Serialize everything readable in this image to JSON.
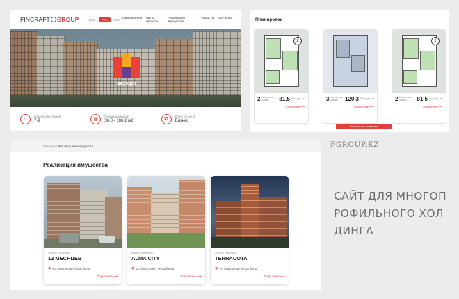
{
  "landing": {
    "logo_left": "FINCRAFT",
    "logo_right": "GROUP",
    "langs": [
      {
        "label": "QAZ",
        "active": false
      },
      {
        "label": "РУС",
        "active": true
      },
      {
        "label": "ENG",
        "active": false
      }
    ],
    "menu": [
      "Направления",
      "Мы о проекте",
      "Реализация имущества",
      "Новости",
      "Контакты"
    ],
    "badge_text": "МЕСЯЦЕВ",
    "stats": [
      {
        "icon": "stairs-icon",
        "label": "Количество этажей",
        "value": "7-9"
      },
      {
        "icon": "area-icon",
        "label": "Площадь квартир",
        "value": "36.8 - 186.2 м2"
      },
      {
        "icon": "medal-icon",
        "label": "Класс объекта",
        "value": "Бизнес"
      }
    ]
  },
  "layouts": {
    "title": "Планировки",
    "items": [
      {
        "rooms": "2",
        "rooms_label": "Количество комнат",
        "area": "81.5",
        "area_label": "Площадь, м2",
        "more": "Подробнее"
      },
      {
        "rooms": "3",
        "rooms_label": "Количество комнат",
        "area": "120.3",
        "area_label": "Площадь, м2",
        "more": "Подробнее"
      },
      {
        "rooms": "2",
        "rooms_label": "Количество комнат",
        "area": "81.5",
        "area_label": "Площадь, м2",
        "more": "Подробнее"
      }
    ],
    "button": "Смотреть все планировки"
  },
  "listing": {
    "breadcrumb_home": "Главная",
    "breadcrumb_sep": "/",
    "breadcrumb_current": "Реализация имущества",
    "title": "Реализация имущества",
    "cards": [
      {
        "type": "Жилой комплекс",
        "name": "12 МЕСЯЦЕВ",
        "address": "ул. Макатаева / Муратбаева",
        "more": "Подробнее"
      },
      {
        "type": "Жилой комплекс",
        "name": "ALMA CITY",
        "address": "ул. Макатаева / Муратбаева",
        "more": "Подробнее"
      },
      {
        "type": "Жилой комплекс",
        "name": "TERRACOTA",
        "address": "ул. Макатаева / Муратбаева",
        "more": "Подробнее"
      }
    ]
  },
  "brand_url": "FGROUP.KZ",
  "caption": "САЙТ ДЛЯ МНОГОПРОФИЛЬНОГО ХОЛДИНГА",
  "colors": {
    "accent": "#e03f3a",
    "background": "#ececec"
  }
}
